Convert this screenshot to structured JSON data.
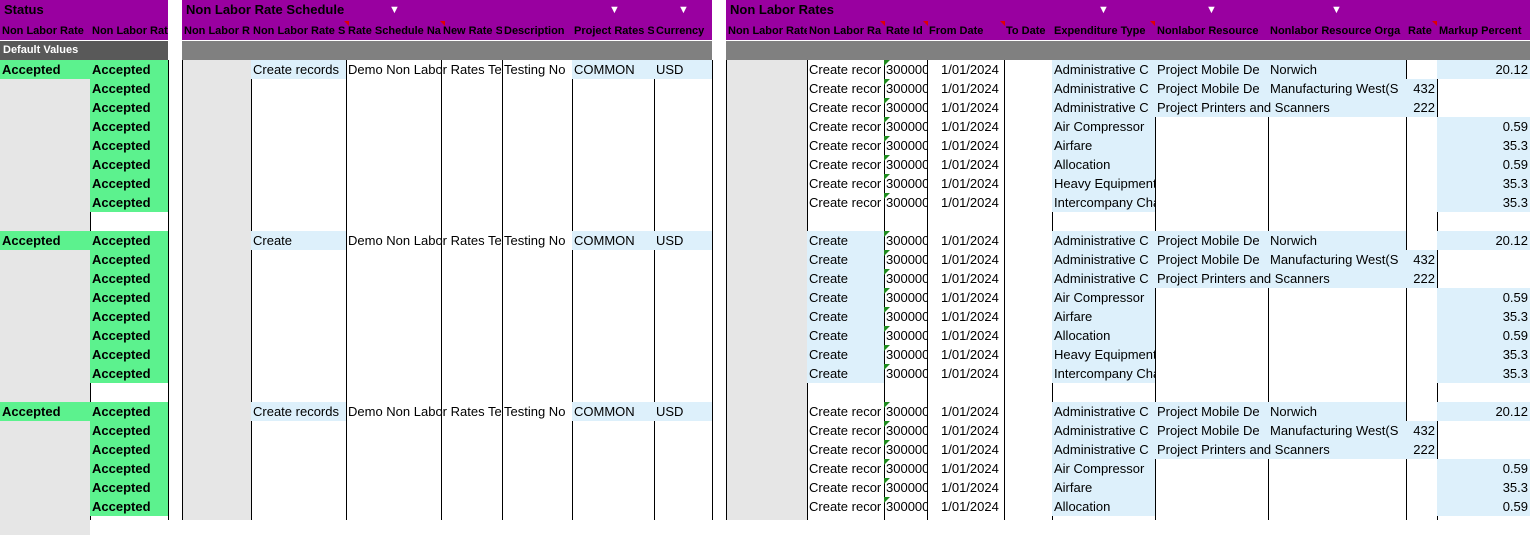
{
  "status_section": {
    "title": "Status",
    "cols": [
      "Non Labor Rate",
      "Non Labor Rat"
    ]
  },
  "schedule_section": {
    "title": "Non Labor Rate Schedule",
    "cols": [
      "Non Labor R",
      "Non Labor Rate S",
      "Rate Schedule Na",
      "New Rate S",
      "Description",
      "Project Rates S",
      "Currency"
    ]
  },
  "rates_section": {
    "title": "Non Labor Rates",
    "cols": [
      "Non Labor Rate",
      "Non Labor Ra",
      "Rate Id",
      "From Date",
      "To Date",
      "Expenditure Type",
      "Nonlabor Resource",
      "Nonlabor Resource Orga",
      "Rate",
      "Markup Percent"
    ]
  },
  "default_values_label": "Default Values",
  "status_value": "Accepted",
  "blocks": [
    {
      "schedule": {
        "action": "Create records",
        "name": "Demo Non Labor Rates Te",
        "description": "Testing No",
        "project_rates": "COMMON",
        "currency": "USD"
      },
      "rows": [
        {
          "action": "Create recor",
          "rate_id": "300000",
          "from_date": "1/01/2024",
          "exp_type": "Administrative C",
          "resource": "Project Mobile De",
          "org": "Norwich",
          "rate": "",
          "markup": "20.12"
        },
        {
          "action": "Create recor",
          "rate_id": "300000",
          "from_date": "1/01/2024",
          "exp_type": "Administrative C",
          "resource": "Project Mobile De",
          "org": "Manufacturing West(S",
          "rate": "432",
          "markup": ""
        },
        {
          "action": "Create recor",
          "rate_id": "300000",
          "from_date": "1/01/2024",
          "exp_type": "Administrative C",
          "resource": "Project Printers and Scanners",
          "org": "",
          "rate": "222",
          "markup": ""
        },
        {
          "action": "Create recor",
          "rate_id": "300000",
          "from_date": "1/01/2024",
          "exp_type": "Air Compressor",
          "resource": "",
          "org": "",
          "rate": "",
          "markup": "0.59"
        },
        {
          "action": "Create recor",
          "rate_id": "300000",
          "from_date": "1/01/2024",
          "exp_type": "Airfare",
          "resource": "",
          "org": "",
          "rate": "",
          "markup": "35.3"
        },
        {
          "action": "Create recor",
          "rate_id": "300000",
          "from_date": "1/01/2024",
          "exp_type": "Allocation",
          "resource": "",
          "org": "",
          "rate": "",
          "markup": "0.59"
        },
        {
          "action": "Create recor",
          "rate_id": "300000",
          "from_date": "1/01/2024",
          "exp_type": "Heavy Equipment.Crane",
          "resource": "",
          "org": "",
          "rate": "",
          "markup": "35.3"
        },
        {
          "action": "Create recor",
          "rate_id": "300000",
          "from_date": "1/01/2024",
          "exp_type": "Intercompany Charge",
          "resource": "",
          "org": "",
          "rate": "",
          "markup": "35.3"
        }
      ]
    },
    {
      "schedule": {
        "action": "Create",
        "name": "Demo Non Labor Rates Te",
        "description": "Testing No",
        "project_rates": "COMMON",
        "currency": "USD"
      },
      "rows": [
        {
          "action": "Create",
          "rate_id": "300000",
          "from_date": "1/01/2024",
          "exp_type": "Administrative C",
          "resource": "Project Mobile De",
          "org": "Norwich",
          "rate": "",
          "markup": "20.12"
        },
        {
          "action": "Create",
          "rate_id": "300000",
          "from_date": "1/01/2024",
          "exp_type": "Administrative C",
          "resource": "Project Mobile De",
          "org": "Manufacturing West(S",
          "rate": "432",
          "markup": ""
        },
        {
          "action": "Create",
          "rate_id": "300000",
          "from_date": "1/01/2024",
          "exp_type": "Administrative C",
          "resource": "Project Printers and Scanners",
          "org": "",
          "rate": "222",
          "markup": ""
        },
        {
          "action": "Create",
          "rate_id": "300000",
          "from_date": "1/01/2024",
          "exp_type": "Air Compressor",
          "resource": "",
          "org": "",
          "rate": "",
          "markup": "0.59"
        },
        {
          "action": "Create",
          "rate_id": "300000",
          "from_date": "1/01/2024",
          "exp_type": "Airfare",
          "resource": "",
          "org": "",
          "rate": "",
          "markup": "35.3"
        },
        {
          "action": "Create",
          "rate_id": "300000",
          "from_date": "1/01/2024",
          "exp_type": "Allocation",
          "resource": "",
          "org": "",
          "rate": "",
          "markup": "0.59"
        },
        {
          "action": "Create",
          "rate_id": "300000",
          "from_date": "1/01/2024",
          "exp_type": "Heavy Equipment.Crane",
          "resource": "",
          "org": "",
          "rate": "",
          "markup": "35.3"
        },
        {
          "action": "Create",
          "rate_id": "300000",
          "from_date": "1/01/2024",
          "exp_type": "Intercompany Charge",
          "resource": "",
          "org": "",
          "rate": "",
          "markup": "35.3"
        }
      ]
    },
    {
      "schedule": {
        "action": "Create records",
        "name": "Demo Non Labor Rates Te",
        "description": "Testing No",
        "project_rates": "COMMON",
        "currency": "USD"
      },
      "rows": [
        {
          "action": "Create recor",
          "rate_id": "300000",
          "from_date": "1/01/2024",
          "exp_type": "Administrative C",
          "resource": "Project Mobile De",
          "org": "Norwich",
          "rate": "",
          "markup": "20.12"
        },
        {
          "action": "Create recor",
          "rate_id": "300000",
          "from_date": "1/01/2024",
          "exp_type": "Administrative C",
          "resource": "Project Mobile De",
          "org": "Manufacturing West(S",
          "rate": "432",
          "markup": ""
        },
        {
          "action": "Create recor",
          "rate_id": "300000",
          "from_date": "1/01/2024",
          "exp_type": "Administrative C",
          "resource": "Project Printers and Scanners",
          "org": "",
          "rate": "222",
          "markup": ""
        },
        {
          "action": "Create recor",
          "rate_id": "300000",
          "from_date": "1/01/2024",
          "exp_type": "Air Compressor",
          "resource": "",
          "org": "",
          "rate": "",
          "markup": "0.59"
        },
        {
          "action": "Create recor",
          "rate_id": "300000",
          "from_date": "1/01/2024",
          "exp_type": "Airfare",
          "resource": "",
          "org": "",
          "rate": "",
          "markup": "35.3"
        },
        {
          "action": "Create recor",
          "rate_id": "300000",
          "from_date": "1/01/2024",
          "exp_type": "Allocation",
          "resource": "",
          "org": "",
          "rate": "",
          "markup": "0.59"
        }
      ]
    }
  ]
}
